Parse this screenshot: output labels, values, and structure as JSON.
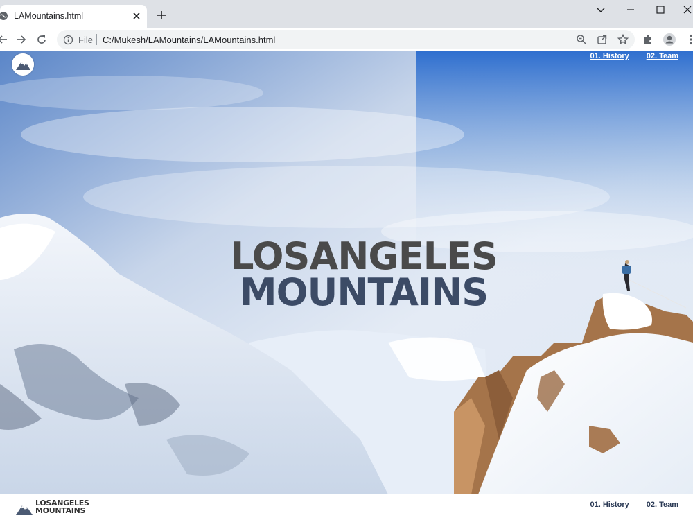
{
  "browser": {
    "tab_title": "LAMountains.html",
    "url_scheme": "File",
    "url": "C:/Mukesh/LAMountains/LAMountains.html"
  },
  "page": {
    "nav": [
      {
        "label": "01. History"
      },
      {
        "label": "02. Team"
      }
    ],
    "hero": {
      "title_line1": "LOSANGELES",
      "title_line2": "MOUNTAINS"
    },
    "footer": {
      "brand_line1": "LOSANGELES",
      "brand_line2": "MOUNTAINS",
      "nav": [
        {
          "label": "01. History"
        },
        {
          "label": "02. Team"
        }
      ]
    }
  },
  "colors": {
    "sky_top": "#3b74c6",
    "title_dark": "#4a4a4a",
    "title_blue": "#3c4b66",
    "footer_link": "#2b3a55"
  }
}
